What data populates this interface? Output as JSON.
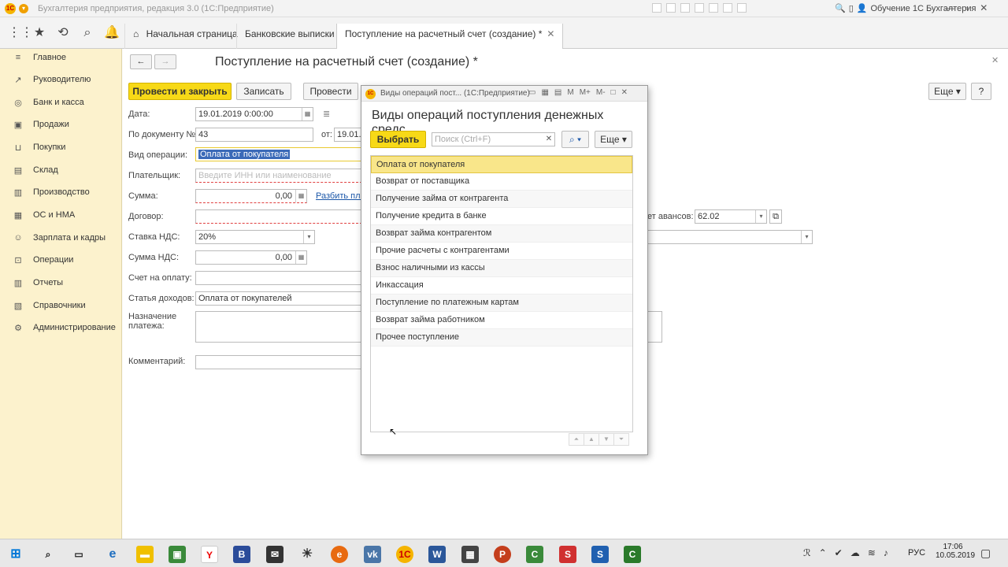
{
  "window": {
    "title": "Бухгалтерия предприятия, редакция 3.0 (1С:Предприятие)",
    "user": "Обучение 1С Бухгалтерия"
  },
  "tabs": [
    {
      "label": "Начальная страница"
    },
    {
      "label": "Банковские выписки"
    },
    {
      "label": "Поступление на расчетный счет (создание) *"
    }
  ],
  "sidebar": {
    "items": [
      {
        "label": "Главное",
        "icon": "menu-icon"
      },
      {
        "label": "Руководителю",
        "icon": "chart-icon"
      },
      {
        "label": "Банк и касса",
        "icon": "bank-icon"
      },
      {
        "label": "Продажи",
        "icon": "sales-icon"
      },
      {
        "label": "Покупки",
        "icon": "cart-icon"
      },
      {
        "label": "Склад",
        "icon": "warehouse-icon"
      },
      {
        "label": "Производство",
        "icon": "factory-icon"
      },
      {
        "label": "ОС и НМА",
        "icon": "assets-icon"
      },
      {
        "label": "Зарплата и кадры",
        "icon": "staff-icon"
      },
      {
        "label": "Операции",
        "icon": "operations-icon"
      },
      {
        "label": "Отчеты",
        "icon": "reports-icon"
      },
      {
        "label": "Справочники",
        "icon": "reference-icon"
      },
      {
        "label": "Администрирование",
        "icon": "settings-icon"
      }
    ]
  },
  "form": {
    "title": "Поступление на расчетный счет (создание) *",
    "post_close_label": "Провести и закрыть",
    "save_label": "Записать",
    "post_label": "Провести",
    "more_label": "Еще",
    "help_label": "?",
    "date_label": "Дата:",
    "date_value": "19.01.2019  0:00:00",
    "docnum_label": "По документу №:",
    "docnum_value": "43",
    "from_label": "от:",
    "from_value": "19.01.",
    "optype_label": "Вид операции:",
    "optype_value": "Оплата от покупателя",
    "payer_label": "Плательщик:",
    "payer_placeholder": "Введите ИНН или наименование",
    "sum_label": "Сумма:",
    "sum_value": "0,00",
    "split_link": "Разбить пла",
    "contract_label": "Договор:",
    "advances_label": "ет авансов:",
    "advances_value": "62.02",
    "vat_rate_label": "Ставка НДС:",
    "vat_rate_value": "20%",
    "vat_sum_label": "Сумма НДС:",
    "vat_sum_value": "0,00",
    "invoice_label": "Счет на оплату:",
    "income_label": "Статья доходов:",
    "income_value": "Оплата от покупателей",
    "purpose_label": "Назначение платежа:",
    "comment_label": "Комментарий:"
  },
  "dialog": {
    "window_title": "Виды операций пост... (1С:Предприятие)",
    "heading": "Виды операций поступления денежных средс...",
    "select_label": "Выбрать",
    "search_placeholder": "Поиск (Ctrl+F)",
    "more_label": "Еще",
    "items": [
      "Оплата от покупателя",
      "Возврат от поставщика",
      "Получение займа от контрагента",
      "Получение кредита в банке",
      "Возврат займа контрагентом",
      "Прочие расчеты с контрагентами",
      "Взнос наличными из кассы",
      "Инкассация",
      "Поступление по платежным картам",
      "Возврат займа работником",
      "Прочее поступление"
    ],
    "selected_index": 0
  },
  "taskbar": {
    "time": "17:06",
    "date": "10.05.2019",
    "lang": "РУС"
  },
  "colors": {
    "sidebar_bg": "#fcf2cd",
    "accent_yellow": "#f7d917",
    "selected_row": "#f9e68a"
  }
}
